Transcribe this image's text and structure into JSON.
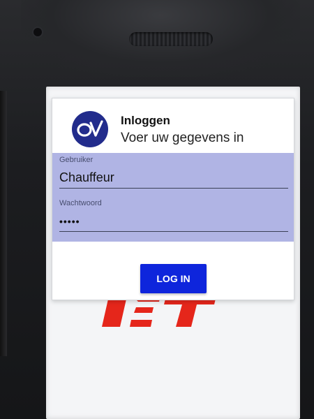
{
  "dialog": {
    "title": "Inloggen",
    "subtitle": "Voer uw gegevens in",
    "logo_icon": "ov-logo-icon"
  },
  "form": {
    "username": {
      "label": "Gebruiker",
      "value": "Chauffeur"
    },
    "password": {
      "label": "Wachtwoord",
      "value": "•••••"
    }
  },
  "actions": {
    "login_label": "LOG IN"
  },
  "colors": {
    "primary_button": "#0e25dc",
    "logo_bg": "#222c8c",
    "form_bg": "#b0b4e4",
    "brand_red": "#e5261b"
  }
}
